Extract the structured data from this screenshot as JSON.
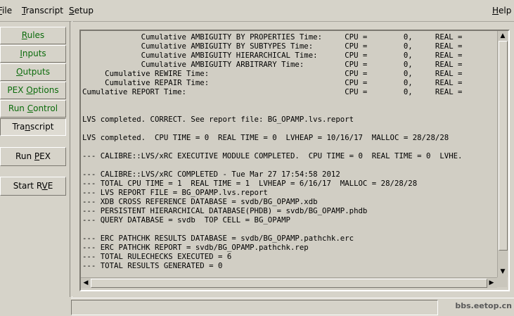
{
  "menubar": {
    "file": {
      "pre": "",
      "u": "F",
      "post": "ile"
    },
    "transcript": {
      "pre": "",
      "u": "T",
      "post": "ranscript"
    },
    "setup": {
      "pre": "",
      "u": "S",
      "post": "etup"
    },
    "help": {
      "pre": "",
      "u": "H",
      "post": "elp"
    }
  },
  "sidebar": {
    "rules": {
      "pre": "",
      "u": "R",
      "post": "ules"
    },
    "inputs": {
      "pre": "",
      "u": "I",
      "post": "nputs"
    },
    "outputs": {
      "pre": "",
      "u": "O",
      "post": "utputs"
    },
    "pex_options": {
      "pre": "PEX ",
      "u": "O",
      "post": "ptions"
    },
    "run_control": {
      "pre": "Run ",
      "u": "C",
      "post": "ontrol"
    },
    "transcript": {
      "pre": "Tra",
      "u": "n",
      "post": "script"
    },
    "run_pex": {
      "pre": "Run ",
      "u": "P",
      "post": "EX"
    },
    "start_rve": {
      "pre": "Start R",
      "u": "V",
      "post": "E"
    }
  },
  "transcript": {
    "lines": [
      "             Cumulative AMBIGUITY BY PROPERTIES Time:     CPU =        0,     REAL =",
      "             Cumulative AMBIGUITY BY SUBTYPES Time:       CPU =        0,     REAL =",
      "             Cumulative AMBIGUITY HIERARCHICAL Time:      CPU =        0,     REAL =",
      "             Cumulative AMBIGUITY ARBITRARY Time:         CPU =        0,     REAL =",
      "     Cumulative REWIRE Time:                              CPU =        0,     REAL =",
      "     Cumulative REPAIR Time:                              CPU =        0,     REAL =",
      "Cumulative REPORT Time:                                   CPU =        0,     REAL =",
      "",
      "",
      "LVS completed. CORRECT. See report file: BG_OPAMP.lvs.report",
      "",
      "LVS completed.  CPU TIME = 0  REAL TIME = 0  LVHEAP = 10/16/17  MALLOC = 28/28/28",
      "",
      "--- CALIBRE::LVS/xRC EXECUTIVE MODULE COMPLETED.  CPU TIME = 0  REAL TIME = 0  LVHE.",
      "",
      "--- CALIBRE::LVS/xRC COMPLETED - Tue Mar 27 17:54:58 2012",
      "--- TOTAL CPU TIME = 1  REAL TIME = 1  LVHEAP = 6/16/17  MALLOC = 28/28/28",
      "--- LVS REPORT FILE = BG_OPAMP.lvs.report",
      "--- XDB CROSS REFERENCE DATABASE = svdb/BG_OPAMP.xdb",
      "--- PERSISTENT HIERARCHICAL DATABASE(PHDB) = svdb/BG_OPAMP.phdb",
      "--- QUERY DATABASE = svdb  TOP CELL = BG_OPAMP",
      "",
      "--- ERC PATHCHK RESULTS DATABASE = svdb/BG_OPAMP.pathchk.erc",
      "--- ERC PATHCHK REPORT = svdb/BG_OPAMP.pathchk.rep",
      "--- TOTAL RULECHECKS EXECUTED = 6",
      "--- TOTAL RESULTS GENERATED = 0"
    ]
  },
  "watermark": "bbs.eetop.cn"
}
